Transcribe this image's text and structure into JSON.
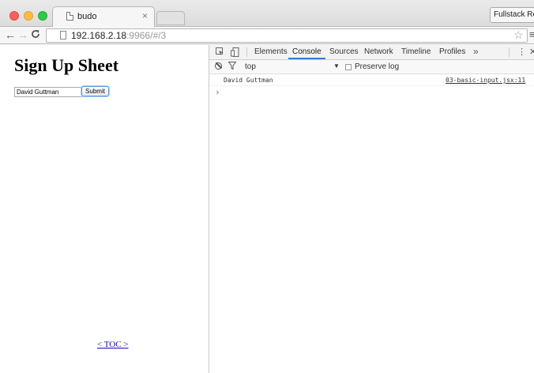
{
  "browser": {
    "tab": {
      "title": "budo",
      "close": "×",
      "icon": "page-icon"
    },
    "extension_button": "Fullstack React",
    "nav": {
      "back": "←",
      "forward": "→",
      "reload": "C"
    },
    "url": {
      "host": "192.168.2.18",
      "rest": ":9966/#/3"
    },
    "star": "☆",
    "menu": "≡"
  },
  "page": {
    "title": "Sign Up Sheet",
    "name_input_value": "David Guttman",
    "submit_label": "Submit",
    "toc_link": "< TOC >"
  },
  "devtools": {
    "tabs": [
      "Elements",
      "Console",
      "Sources",
      "Network",
      "Timeline",
      "Profiles"
    ],
    "active_tab": "Console",
    "more": "»",
    "kebab": "⋮",
    "close": "✕",
    "context": "top",
    "context_caret": "▼",
    "preserve_log_label": "Preserve log",
    "log_message": "David Guttman",
    "log_source": "03-basic-input.jsx:11",
    "prompt": "›"
  },
  "colors": {
    "accent": "#3879d9",
    "link": "#1a0dab"
  }
}
